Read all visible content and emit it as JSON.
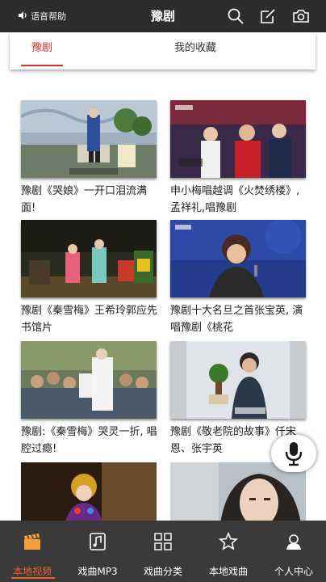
{
  "header": {
    "voice_help": "语音帮助",
    "title": "豫剧",
    "icons": [
      "search-icon",
      "edit-icon",
      "camera-icon"
    ]
  },
  "tabs": [
    {
      "label": "豫剧",
      "active": true
    },
    {
      "label": "我的收藏",
      "active": false
    }
  ],
  "videos": [
    {
      "caption": "豫剧《哭娘》一开口泪流满面!"
    },
    {
      "caption": "申小梅唱越调《火焚绣楼》, 孟祥礼,唱豫剧"
    },
    {
      "caption": "豫剧《秦雪梅》王希玲郭应先 书馆片"
    },
    {
      "caption": "豫剧十大名旦之首张宝英, 演唱豫剧《桃花"
    },
    {
      "caption": "豫剧:《秦雪梅》哭灵一折, 唱腔过瘾!"
    },
    {
      "caption": "豫剧《敬老院的故事》仟宋恩、张宇英"
    },
    {
      "caption": ""
    },
    {
      "caption": ""
    }
  ],
  "bottom_nav": [
    {
      "label": "本地视频",
      "icon": "clapperboard-icon",
      "active": true
    },
    {
      "label": "戏曲MP3",
      "icon": "music-note-icon",
      "active": false
    },
    {
      "label": "戏曲分类",
      "icon": "grid-icon",
      "active": false
    },
    {
      "label": "本地戏曲",
      "icon": "star-icon",
      "active": false
    },
    {
      "label": "个人中心",
      "icon": "person-icon",
      "active": false
    }
  ],
  "colors": {
    "header_bg": "#2d2d2d",
    "accent_red": "#d9322b",
    "nav_bg": "#3a3a3a",
    "nav_active": "#e8622c"
  }
}
